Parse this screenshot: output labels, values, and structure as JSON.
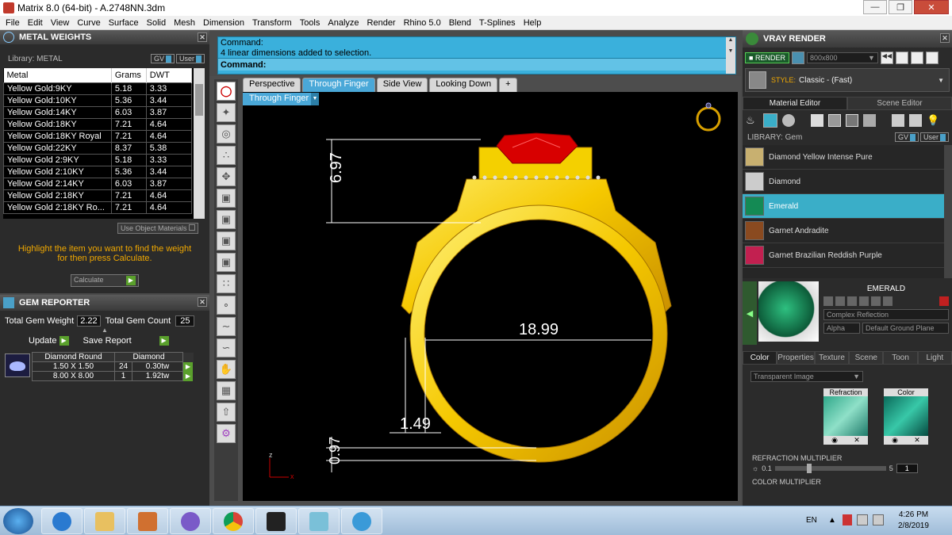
{
  "window": {
    "title": "Matrix 8.0 (64-bit) - A.2748NN.3dm"
  },
  "menu": [
    "File",
    "Edit",
    "View",
    "Curve",
    "Surface",
    "Solid",
    "Mesh",
    "Dimension",
    "Transform",
    "Tools",
    "Analyze",
    "Render",
    "Rhino 5.0",
    "Blend",
    "T-Splines",
    "Help"
  ],
  "metal_weights": {
    "title": "METAL WEIGHTS",
    "library_label": "Library: METAL",
    "gv": "GV",
    "user": "User",
    "columns": [
      "Metal",
      "Grams",
      "DWT"
    ],
    "rows": [
      [
        "Yellow Gold:9KY",
        "5.18",
        "3.33"
      ],
      [
        "Yellow Gold:10KY",
        "5.36",
        "3.44"
      ],
      [
        "Yellow Gold:14KY",
        "6.03",
        "3.87"
      ],
      [
        "Yellow Gold:18KY",
        "7.21",
        "4.64"
      ],
      [
        "Yellow Gold:18KY Royal",
        "7.21",
        "4.64"
      ],
      [
        "Yellow Gold:22KY",
        "8.37",
        "5.38"
      ],
      [
        "Yellow Gold 2:9KY",
        "5.18",
        "3.33"
      ],
      [
        "Yellow Gold 2:10KY",
        "5.36",
        "3.44"
      ],
      [
        "Yellow Gold 2:14KY",
        "6.03",
        "3.87"
      ],
      [
        "Yellow Gold 2:18KY",
        "7.21",
        "4.64"
      ],
      [
        "Yellow Gold 2:18KY Ro...",
        "7.21",
        "4.64"
      ]
    ],
    "use_object_materials": "Use Object Materials",
    "instruction": "Highlight the item you want to find the weight for then press Calculate.",
    "calculate": "Calculate"
  },
  "gem_reporter": {
    "title": "GEM REPORTER",
    "total_weight_label": "Total Gem Weight",
    "total_weight": "2.22",
    "total_count_label": "Total Gem Count",
    "total_count": "25",
    "update": "Update",
    "save_report": "Save Report",
    "headers": [
      "Diamond Round",
      "Diamond"
    ],
    "rows": [
      [
        "1.50 X 1.50",
        "24",
        "0.30tw"
      ],
      [
        "8.00 X 8.00",
        "1",
        "1.92tw"
      ]
    ]
  },
  "command": {
    "line1": "Command:",
    "line2": "4 linear dimensions added to selection.",
    "prompt": "Command:"
  },
  "viewport": {
    "tabs": [
      "Perspective",
      "Through Finger",
      "Side View",
      "Looking Down",
      "+"
    ],
    "active_tab": "Through Finger",
    "view_label": "Through Finger",
    "dims": {
      "top_height": "6.97",
      "width": "18.99",
      "shank": "1.49",
      "bottom": "0.97"
    },
    "axis_z": "z",
    "axis_x": "x"
  },
  "vray": {
    "title": "VRAY RENDER",
    "render": "RENDER",
    "resolution": "800x800",
    "style_label": "STYLE:",
    "style_value": "Classic - (Fast)",
    "tabs": [
      "Material Editor",
      "Scene Editor"
    ],
    "library_label": "LIBRARY: Gem",
    "gv": "GV",
    "user": "User",
    "materials": [
      "Diamond Yellow Intense Pure",
      "Diamond",
      "Emerald",
      "Garnet Andradite",
      "Garnet Brazilian Reddish Purple"
    ],
    "selected_material": "Emerald",
    "preview_name": "EMERALD",
    "reflection": "Complex Reflection",
    "alpha": "Alpha",
    "ground": "Default Ground Plane",
    "prop_tabs": [
      "Color",
      "Properties",
      "Texture",
      "Scene",
      "Toon",
      "Light"
    ],
    "transparent": "Transparent Image",
    "refraction_label": "Refraction",
    "color_label": "Color",
    "refraction_multiplier": "REFRACTION MULTIPLIER",
    "rm_min": "0.1",
    "rm_max": "5",
    "rm_value": "1",
    "color_multiplier": "COLOR MULTIPLIER"
  },
  "taskbar": {
    "lang": "EN",
    "time": "4:26 PM",
    "date": "2/8/2019"
  }
}
